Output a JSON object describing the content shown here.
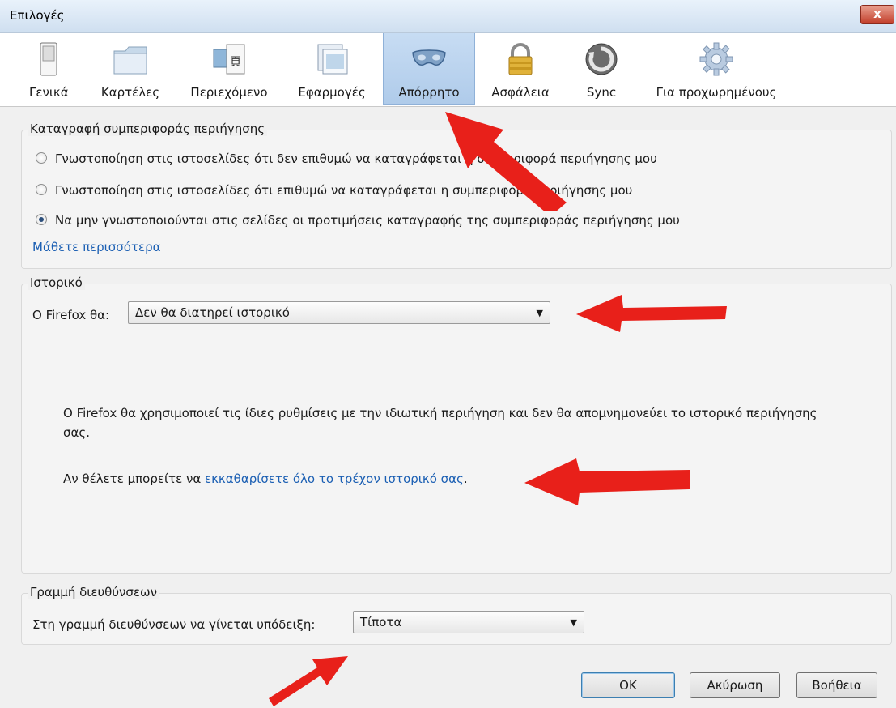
{
  "window": {
    "title": "Επιλογές",
    "close_label": "x"
  },
  "tabs": [
    {
      "id": "general",
      "label": "Γενικά",
      "icon": "general-switch-icon"
    },
    {
      "id": "tabs",
      "label": "Καρτέλες",
      "icon": "tabs-folder-icon"
    },
    {
      "id": "content",
      "label": "Περιεχόμενο",
      "icon": "content-image-icon"
    },
    {
      "id": "applications",
      "label": "Εφαρμογές",
      "icon": "applications-window-icon"
    },
    {
      "id": "privacy",
      "label": "Απόρρητο",
      "icon": "mask-icon",
      "active": true
    },
    {
      "id": "security",
      "label": "Ασφάλεια",
      "icon": "padlock-icon"
    },
    {
      "id": "sync",
      "label": "Sync",
      "icon": "sync-icon"
    },
    {
      "id": "advanced",
      "label": "Για προχωρημένους",
      "icon": "gear-icon"
    }
  ],
  "tracking": {
    "title": "Καταγραφή συμπεριφοράς περιήγησης",
    "options": [
      {
        "label": "Γνωστοποίηση στις ιστοσελίδες ότι δεν επιθυμώ να καταγράφεται η συμπεριφορά περιήγησης μου",
        "selected": false
      },
      {
        "label": "Γνωστοποίηση στις ιστοσελίδες ότι επιθυμώ να καταγράφεται η συμπεριφορά περιήγησης μου",
        "selected": false
      },
      {
        "label": "Να μην γνωστοποιούνται στις σελίδες οι προτιμήσεις καταγραφής της συμπεριφοράς περιήγησης μου",
        "selected": true
      }
    ],
    "learn_more": "Μάθετε περισσότερα"
  },
  "history": {
    "title": "Ιστορικό",
    "firefox_will_label": "Ο Firefox θα:",
    "firefox_will_value": "Δεν θα διατηρεί ιστορικό",
    "description": "Ο Firefox θα χρησιμοποιεί τις ίδιες ρυθμίσεις με την ιδιωτική περιήγηση και δεν θα απομνημονεύει το ιστορικό περιήγησης σας.",
    "clear_prefix": "Αν θέλετε μπορείτε να ",
    "clear_link": "εκκαθαρίσετε όλο το τρέχον ιστορικό σας",
    "clear_suffix": "."
  },
  "location_bar": {
    "title": "Γραμμή διευθύνσεων",
    "suggest_label": "Στη γραμμή διευθύνσεων να γίνεται υπόδειξη:",
    "suggest_value": "Τίποτα"
  },
  "buttons": {
    "ok": "OK",
    "cancel": "Ακύρωση",
    "help": "Βοήθεια"
  },
  "colors": {
    "annotation_arrow": "#e8201a",
    "link": "#1b5fb3",
    "active_tab": "#b9d1ee"
  }
}
